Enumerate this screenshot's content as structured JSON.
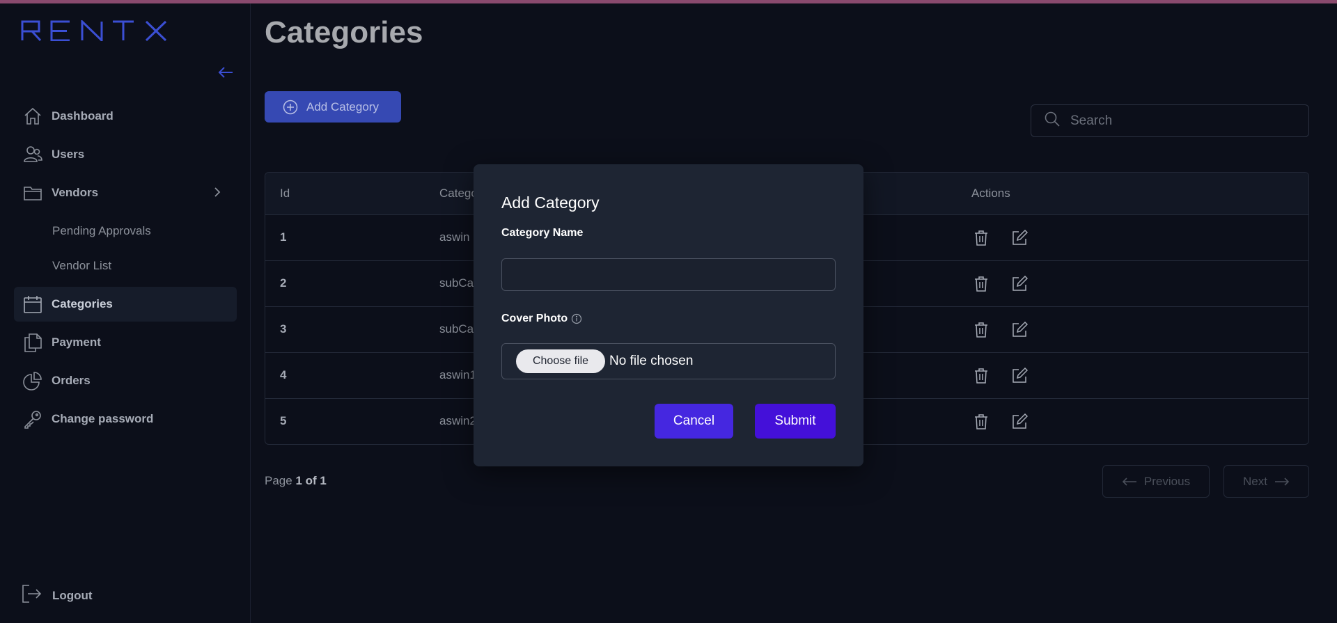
{
  "brand": {
    "logo_text": "RENTX"
  },
  "sidebar": {
    "items": [
      {
        "label": "Dashboard",
        "icon": "home-icon"
      },
      {
        "label": "Users",
        "icon": "users-icon"
      },
      {
        "label": "Vendors",
        "icon": "folder-icon"
      },
      {
        "label": "Categories",
        "icon": "calendar-icon",
        "active": true
      },
      {
        "label": "Payment",
        "icon": "documents-icon"
      },
      {
        "label": "Orders",
        "icon": "pie-chart-icon"
      },
      {
        "label": "Change password",
        "icon": "key-icon"
      }
    ],
    "vendor_sub_items": [
      {
        "label": "Pending Approvals"
      },
      {
        "label": "Vendor List"
      }
    ],
    "logout_label": "Logout"
  },
  "main": {
    "title": "Categories",
    "add_button_label": "Add Category",
    "search_placeholder": "Search",
    "table": {
      "columns": [
        "Id",
        "Catego",
        "Actions"
      ],
      "rows": [
        {
          "id": "1",
          "category": "aswin"
        },
        {
          "id": "2",
          "category": "subCa"
        },
        {
          "id": "3",
          "category": "subCa"
        },
        {
          "id": "4",
          "category": "aswin1"
        },
        {
          "id": "5",
          "category": "aswin2"
        }
      ]
    },
    "pagination": {
      "page_prefix": "Page",
      "page_value": "1 of 1",
      "previous_label": "Previous",
      "next_label": "Next"
    }
  },
  "modal": {
    "title": "Add Category",
    "category_name_label": "Category Name",
    "category_name_value": "",
    "cover_photo_label": "Cover Photo",
    "choose_file_label": "Choose file",
    "no_file_text": "No file chosen",
    "cancel_label": "Cancel",
    "submit_label": "Submit"
  },
  "colors": {
    "background": "#0c0f1a",
    "accent_blue": "#3649b3",
    "cancel_button": "#4527e0",
    "submit_button": "#4410d9",
    "modal_bg": "#1e2533",
    "top_bar": "#8a4a6e"
  }
}
